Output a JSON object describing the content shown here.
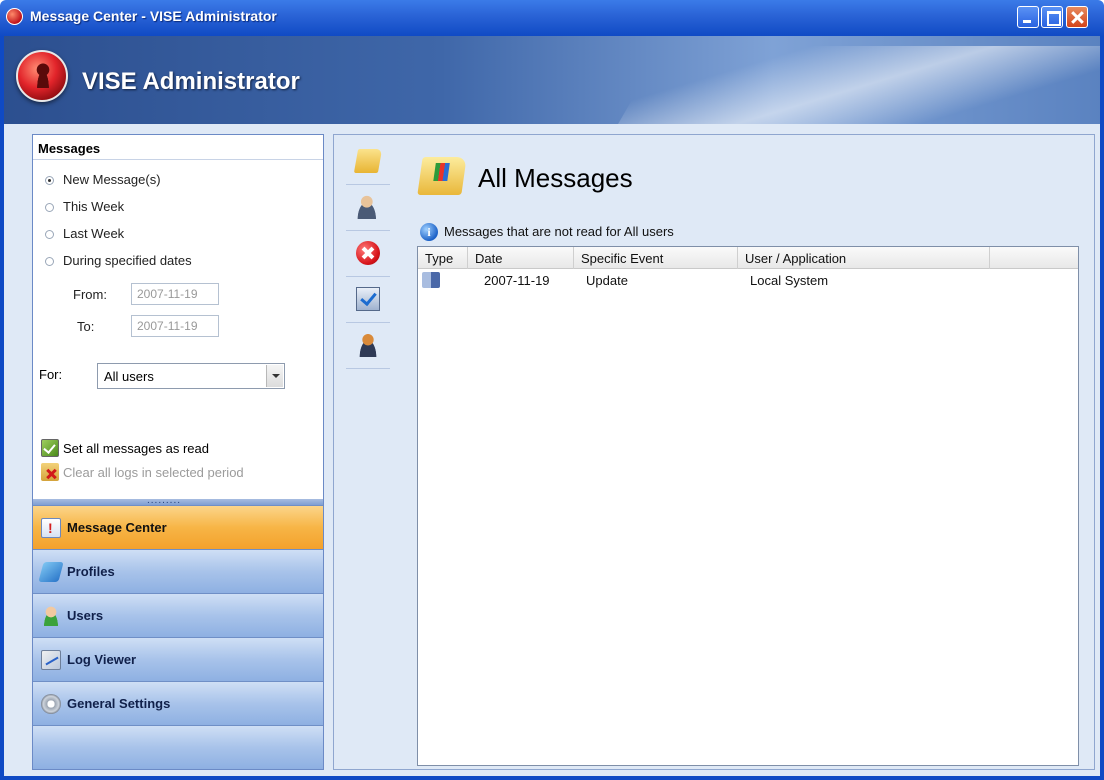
{
  "window": {
    "title": "Message Center - VISE Administrator"
  },
  "banner": {
    "app_name": "VISE Administrator"
  },
  "messages_panel": {
    "header": "Messages",
    "options": [
      {
        "label": "New Message(s)",
        "checked": true
      },
      {
        "label": "This Week",
        "checked": false
      },
      {
        "label": "Last Week",
        "checked": false
      },
      {
        "label": "During specified dates",
        "checked": false
      }
    ],
    "from_label": "From:",
    "from_value": "2007-11-19",
    "to_label": "To:",
    "to_value": "2007-11-19",
    "for_label": "For:",
    "for_value": "All users",
    "set_read": "Set all messages as read",
    "clear_logs": "Clear all logs in selected period",
    "grip": "........."
  },
  "nav": {
    "items": [
      {
        "label": "Message Center",
        "icon": "message-center-icon",
        "active": true
      },
      {
        "label": "Profiles",
        "icon": "profiles-icon",
        "active": false
      },
      {
        "label": "Users",
        "icon": "users-icon",
        "active": false
      },
      {
        "label": "Log Viewer",
        "icon": "log-viewer-icon",
        "active": false
      },
      {
        "label": "General Settings",
        "icon": "gear-icon",
        "active": false
      }
    ]
  },
  "toolstrip": {
    "tools": [
      "all-messages-folder-icon",
      "user-question-icon",
      "error-icon",
      "check-list-icon",
      "person-icon"
    ]
  },
  "content": {
    "title": "All Messages",
    "info": "Messages that are not read for All users",
    "columns": [
      "Type",
      "Date",
      "Specific Event",
      "User / Application"
    ],
    "rows": [
      {
        "type_icon": "update-icon",
        "date": "2007-11-19",
        "event": "Update",
        "user": "Local System"
      }
    ]
  }
}
